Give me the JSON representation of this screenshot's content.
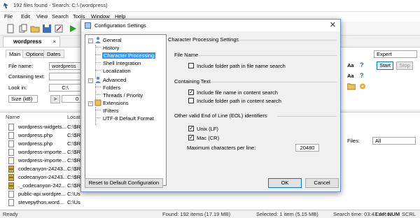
{
  "window": {
    "title": "192 files found - Search: C:\\ (wordpress)"
  },
  "menu": [
    "File",
    "Edit",
    "View",
    "Search",
    "Tools",
    "Window",
    "Help"
  ],
  "document_tab": {
    "label": "wordpress",
    "close": "×"
  },
  "search_panel": {
    "tabs": [
      "Main",
      "Options",
      "Dates"
    ],
    "file_name_label": "File name:",
    "file_name_value": "wordpress",
    "containing_text_label": "Containing text:",
    "look_in_label": "Look in:",
    "look_in_value": "C:\\",
    "size_label": "Size (kB)",
    "size_op": ">",
    "size_value": "0",
    "mode_value": "Expert",
    "start_label": "Start",
    "stop_label": "Stop",
    "files_label": "Files:",
    "files_value": "All",
    "aa_label": "Aa"
  },
  "results": {
    "columns": [
      "Name",
      "Locat"
    ],
    "rows": [
      {
        "name": "wordpress-widgets...",
        "loc": "C:\\$R"
      },
      {
        "name": "wordpress.php",
        "loc": "C:\\$R"
      },
      {
        "name": "wordpress.php",
        "loc": "C:\\$R"
      },
      {
        "name": "wordpress-importe...",
        "loc": "C:\\$R"
      },
      {
        "name": "wordpress-importe...",
        "loc": "C:\\$R"
      },
      {
        "name": "codecanyon-24243...",
        "loc": "C:\\$R"
      },
      {
        "name": "codecanyon-24243...",
        "loc": "C:\\$R"
      },
      {
        "name": "._codecanyon-242...",
        "loc": "C:\\$R"
      },
      {
        "name": "public-api.wordpre...",
        "loc": "C:\\Us"
      },
      {
        "name": "stevepython.word...",
        "loc": "C:\\Us"
      }
    ]
  },
  "status": {
    "ready": "Ready",
    "found": "Found: 192 items (17.19 MB)",
    "selected": "Selected: 1 item (5.15 MB)",
    "time": "Search time: 03:43 secs",
    "cap": "CAP",
    "num": "NUM",
    "scrl": "SCRL"
  },
  "dialog": {
    "title": "Configuration Settings",
    "close": "✕",
    "tree": {
      "general": "General",
      "history": "History",
      "character_processing": "Character Processing",
      "shell_integration": "Shell Integration",
      "localization": "Localization",
      "advanced": "Advanced",
      "folders": "Folders",
      "threads": "Threads / Priority",
      "extensions": "Extensions",
      "ifilters": "IFilters",
      "utf8": "UTF-8 Default Format"
    },
    "heading": "Character Processing Settings",
    "file_name_group": "File Name",
    "include_folder_path_name": "Include folder path in file name search",
    "containing_text_group": "Containing Text",
    "include_file_name_content": "Include file name in content search",
    "include_folder_path_content": "Include folder path in content search",
    "eol_group": "Other valid End of Line (EOL) identifiers",
    "unix_lf": "Unix (LF)",
    "mac_cr": "Mac (CR)",
    "max_chars_label": "Maximum characters per line:",
    "max_chars_value": "20480",
    "reset_button": "Reset to Default Configuration",
    "ok_button": "OK",
    "cancel_button": "Cancel",
    "checks": {
      "include_folder_path_name": false,
      "include_file_name_content": true,
      "include_folder_path_content": false,
      "unix_lf": true,
      "mac_cr": true
    }
  },
  "colors": {
    "selection": "#3399ff",
    "accent_border": "#0078d7",
    "dialog_border": "#6b8fc7"
  }
}
